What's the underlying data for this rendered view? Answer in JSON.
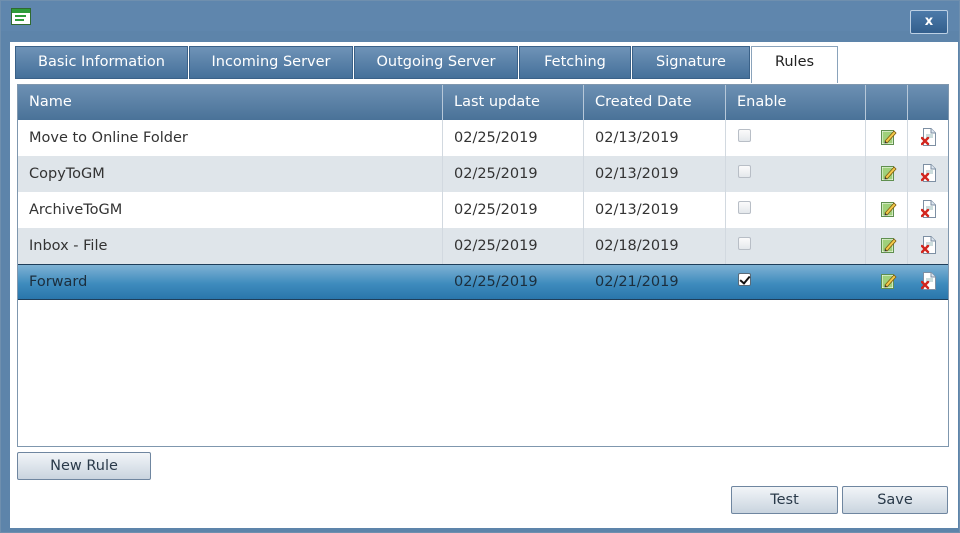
{
  "window": {
    "close_label": "x"
  },
  "tabs": [
    {
      "label": "Basic Information"
    },
    {
      "label": "Incoming Server"
    },
    {
      "label": "Outgoing Server"
    },
    {
      "label": "Fetching"
    },
    {
      "label": "Signature"
    },
    {
      "label": "Rules",
      "active": true
    }
  ],
  "grid": {
    "columns": [
      "Name",
      "Last update",
      "Created Date",
      "Enable",
      "",
      ""
    ],
    "rows": [
      {
        "name": "Move to Online Folder",
        "last_update": "02/25/2019",
        "created": "02/13/2019",
        "enabled": false
      },
      {
        "name": "CopyToGM",
        "last_update": "02/25/2019",
        "created": "02/13/2019",
        "enabled": false
      },
      {
        "name": "ArchiveToGM",
        "last_update": "02/25/2019",
        "created": "02/13/2019",
        "enabled": false
      },
      {
        "name": "Inbox - File",
        "last_update": "02/25/2019",
        "created": "02/18/2019",
        "enabled": false
      },
      {
        "name": "Forward",
        "last_update": "02/25/2019",
        "created": "02/21/2019",
        "enabled": true,
        "selected": true
      }
    ],
    "row_icons": {
      "edit": "edit-icon",
      "delete": "delete-icon"
    }
  },
  "buttons": {
    "new_rule": "New Rule",
    "test": "Test",
    "save": "Save"
  },
  "colors": {
    "titlebar": "#5f86ad",
    "header": "#5b82a8",
    "selected_row": "#3e8bbd",
    "alt_row": "#dfe5ea"
  }
}
